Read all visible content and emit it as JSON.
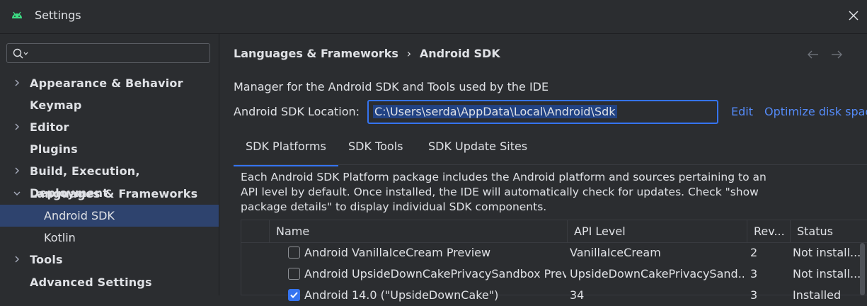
{
  "window": {
    "title": "Settings"
  },
  "search": {
    "placeholder": ""
  },
  "sidebar": {
    "items": [
      {
        "label": "Appearance & Behavior"
      },
      {
        "label": "Keymap"
      },
      {
        "label": "Editor"
      },
      {
        "label": "Plugins"
      },
      {
        "label": "Build, Execution, Deployment"
      },
      {
        "label": "Languages & Frameworks"
      },
      {
        "label": "Android SDK"
      },
      {
        "label": "Kotlin"
      },
      {
        "label": "Tools"
      },
      {
        "label": "Advanced Settings"
      }
    ]
  },
  "main": {
    "breadcrumb": {
      "parent": "Languages & Frameworks",
      "separator": "›",
      "current": "Android SDK"
    },
    "description": "Manager for the Android SDK and Tools used by the IDE",
    "location_label": "Android SDK Location:",
    "location_value": "C:\\Users\\serda\\AppData\\Local\\Android\\Sdk",
    "edit_link": "Edit",
    "optimize_link": "Optimize disk spac",
    "tabs": [
      {
        "label": "SDK Platforms"
      },
      {
        "label": "SDK Tools"
      },
      {
        "label": "SDK Update Sites"
      }
    ],
    "info_text": "Each Android SDK Platform package includes the Android platform and sources pertaining to an API level by default. Once installed, the IDE will automatically check for updates. Check \"show package details\" to display individual SDK components."
  },
  "table": {
    "headers": {
      "name": "Name",
      "api": "API Level",
      "rev": "Rev...",
      "status": "Status"
    },
    "rows": [
      {
        "name": "Android VanillaIceCream Preview",
        "api": "VanillaIceCream",
        "rev": "2",
        "status": "Not install...",
        "checked": false
      },
      {
        "name": "Android UpsideDownCakePrivacySandbox Previ",
        "api": "UpsideDownCakePrivacySand...",
        "rev": "3",
        "status": "Not install...",
        "checked": false
      },
      {
        "name": "Android 14.0 (\"UpsideDownCake\")",
        "api": "34",
        "rev": "3",
        "status": "Installed",
        "checked": true
      }
    ]
  },
  "colors": {
    "accent": "#3574f0",
    "link": "#548af7",
    "selection": "#2e436e",
    "background": "#2b2d30"
  },
  "icons": [
    "android-icon",
    "close-icon",
    "search-icon",
    "chevron-right-icon",
    "chevron-down-icon",
    "arrow-back-icon",
    "arrow-forward-icon",
    "checkbox-checked-icon"
  ]
}
